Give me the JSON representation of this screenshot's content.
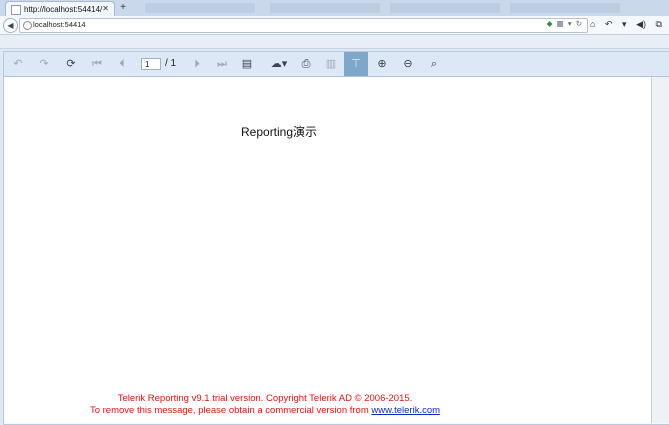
{
  "browser": {
    "tab_title": "http://localhost:54414/",
    "url": "localhost:54414"
  },
  "toolbar": {
    "page_current": "1",
    "page_total": "/ 1"
  },
  "report": {
    "title": "Reporting演示",
    "trial_line1": "Telerik Reporting v9.1 trial version. Copyright Telerik AD © 2006-2015.",
    "trial_line2_prefix": "To remove this message, please obtain a commercial version from ",
    "trial_link": "www.telerik.com"
  },
  "colors": {
    "trial_text": "#e0160f",
    "link": "#0b2ad1",
    "toolbar_bg": "#dce8f5",
    "active_button": "#7fa7c9"
  }
}
